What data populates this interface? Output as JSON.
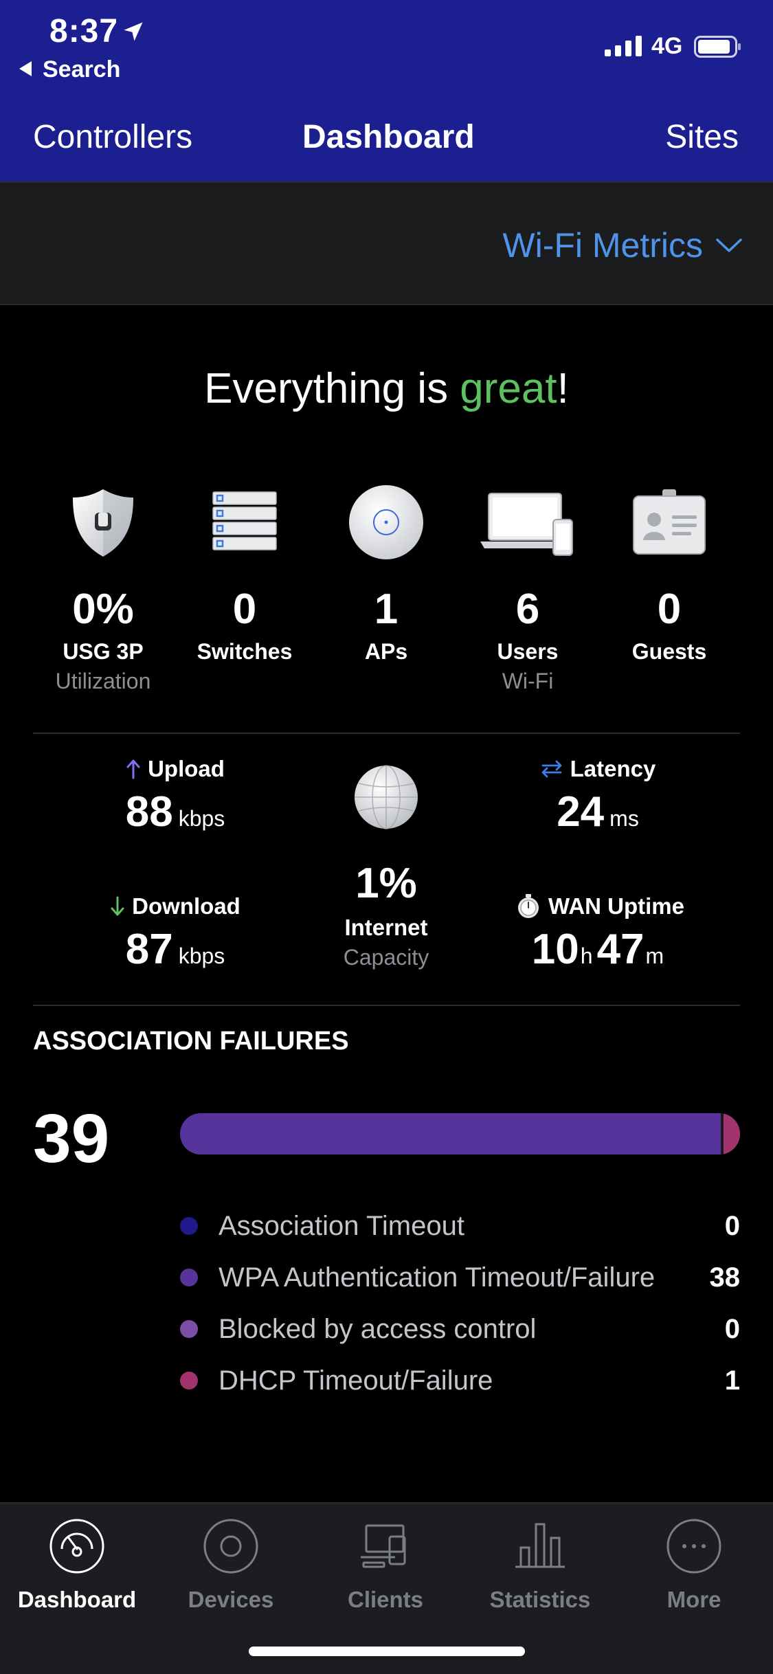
{
  "status_bar": {
    "time": "8:37",
    "back_label": "Search",
    "network": "4G"
  },
  "header": {
    "left": "Controllers",
    "title": "Dashboard",
    "right": "Sites"
  },
  "metrics_select": {
    "label": "Wi-Fi Metrics"
  },
  "headline": {
    "prefix": "Everything is ",
    "status_word": "great",
    "suffix": "!"
  },
  "devices": [
    {
      "value": "0%",
      "label": "USG 3P",
      "sub": "Utilization",
      "icon": "shield-icon"
    },
    {
      "value": "0",
      "label": "Switches",
      "sub": "",
      "icon": "switch-icon"
    },
    {
      "value": "1",
      "label": "APs",
      "sub": "",
      "icon": "access-point-icon"
    },
    {
      "value": "6",
      "label": "Users",
      "sub": "Wi-Fi",
      "icon": "devices-icon"
    },
    {
      "value": "0",
      "label": "Guests",
      "sub": "",
      "icon": "guest-badge-icon"
    }
  ],
  "wan": {
    "upload": {
      "label": "Upload",
      "value": "88",
      "unit": "kbps"
    },
    "download": {
      "label": "Download",
      "value": "87",
      "unit": "kbps"
    },
    "latency": {
      "label": "Latency",
      "value": "24",
      "unit": "ms"
    },
    "internet": {
      "value": "1%",
      "label": "Internet",
      "sub": "Capacity"
    },
    "uptime": {
      "label": "WAN Uptime",
      "hours": "10",
      "hours_unit": "h",
      "minutes": "47",
      "minutes_unit": "m"
    }
  },
  "association": {
    "title": "ASSOCIATION FAILURES",
    "total": "39",
    "items": [
      {
        "label": "Association Timeout",
        "value": "0",
        "color": "#1f1a8a"
      },
      {
        "label": "WPA Authentication Timeout/Failure",
        "value": "38",
        "color": "#56349b"
      },
      {
        "label": "Blocked by access control",
        "value": "0",
        "color": "#7b4ea8"
      },
      {
        "label": "DHCP Timeout/Failure",
        "value": "1",
        "color": "#a3336c"
      }
    ]
  },
  "tabs": [
    {
      "label": "Dashboard",
      "icon": "dashboard-gauge-icon",
      "active": true
    },
    {
      "label": "Devices",
      "icon": "devices-disc-icon",
      "active": false
    },
    {
      "label": "Clients",
      "icon": "clients-icon",
      "active": false
    },
    {
      "label": "Statistics",
      "icon": "statistics-bars-icon",
      "active": false
    },
    {
      "label": "More",
      "icon": "more-dots-icon",
      "active": false
    }
  ],
  "colors": {
    "header_bg": "#1c1f8f",
    "accent_blue": "#4f93ea",
    "good_green": "#5cc15e"
  }
}
